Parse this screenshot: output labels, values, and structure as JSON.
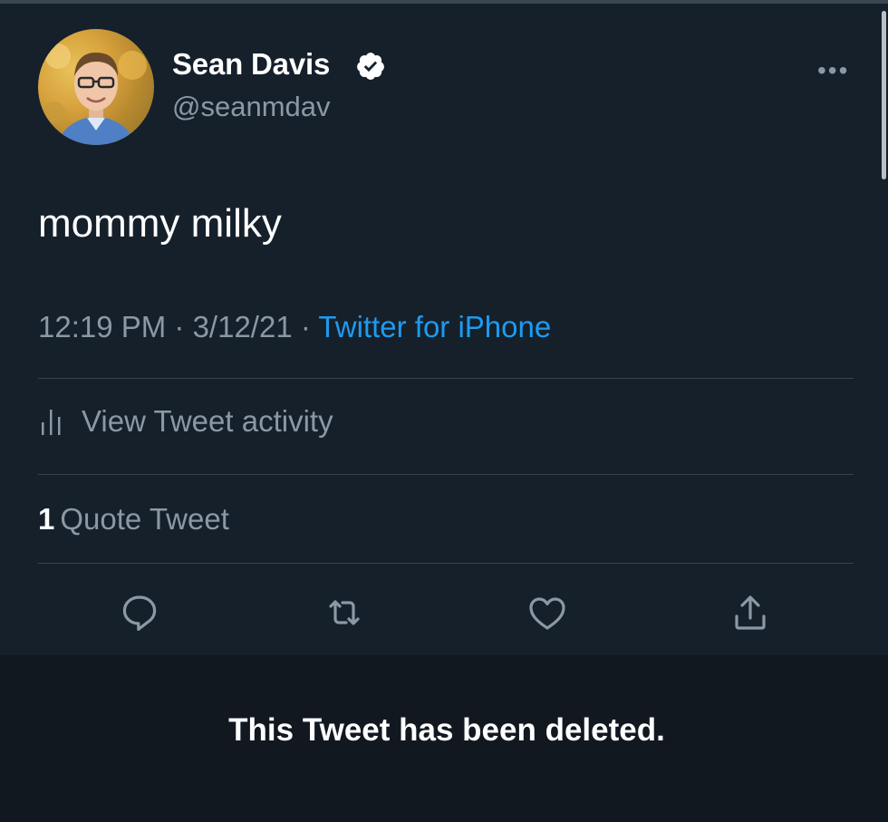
{
  "user": {
    "name": "Sean Davis",
    "handle": "@seanmdav",
    "verified_icon": "verified-badge-icon",
    "more_icon": "more-options-icon",
    "more_label": "•••"
  },
  "tweet": {
    "text": "mommy milky",
    "time": "12:19 PM",
    "separator1": " · ",
    "date": "3/12/21",
    "separator2": " · ",
    "source": "Twitter for iPhone"
  },
  "activity": {
    "label": "View Tweet activity",
    "icon": "bar-chart-icon"
  },
  "quotes": {
    "count": "1",
    "label": "Quote Tweet"
  },
  "actions": [
    {
      "name": "reply",
      "icon": "reply-icon"
    },
    {
      "name": "retweet",
      "icon": "retweet-icon"
    },
    {
      "name": "like",
      "icon": "heart-icon"
    },
    {
      "name": "share",
      "icon": "share-icon"
    }
  ],
  "notice": {
    "text": "This Tweet has been deleted."
  },
  "colors": {
    "background": "#15202b",
    "accent": "#1d9bf0",
    "secondary_text": "#8b98a5",
    "divider": "#38444d",
    "deleted_bar": "#111820"
  }
}
